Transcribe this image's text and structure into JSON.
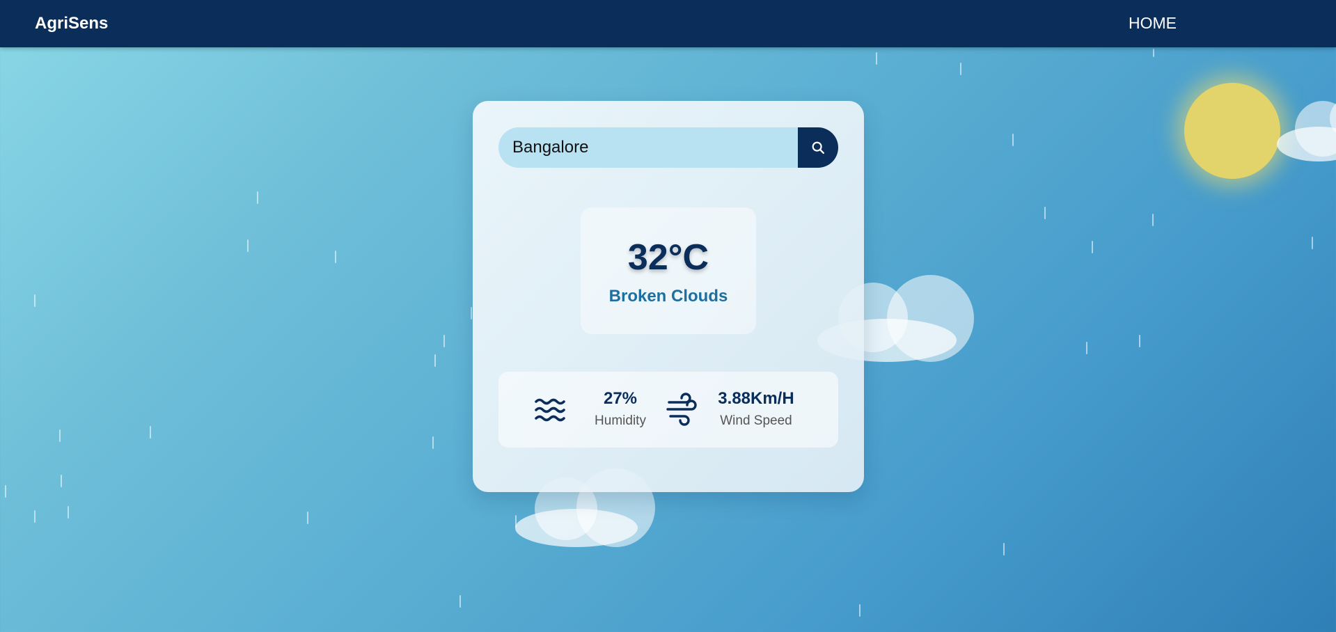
{
  "navbar": {
    "brand": "AgriSens",
    "home_label": "HOME"
  },
  "search": {
    "value": "Bangalore"
  },
  "weather": {
    "temperature": "32°C",
    "description": "Broken Clouds"
  },
  "stats": {
    "humidity_value": "27%",
    "humidity_label": "Humidity",
    "wind_value": "3.88Km/H",
    "wind_label": "Wind Speed"
  },
  "colors": {
    "navbar": "#0b2d5a",
    "accent": "#1d6f9f",
    "search_field": "#b8e1f1",
    "sun": "#e2d46a"
  },
  "icons": {
    "search_button": "search-icon",
    "humidity": "water-waves-icon",
    "wind": "wind-icon"
  }
}
